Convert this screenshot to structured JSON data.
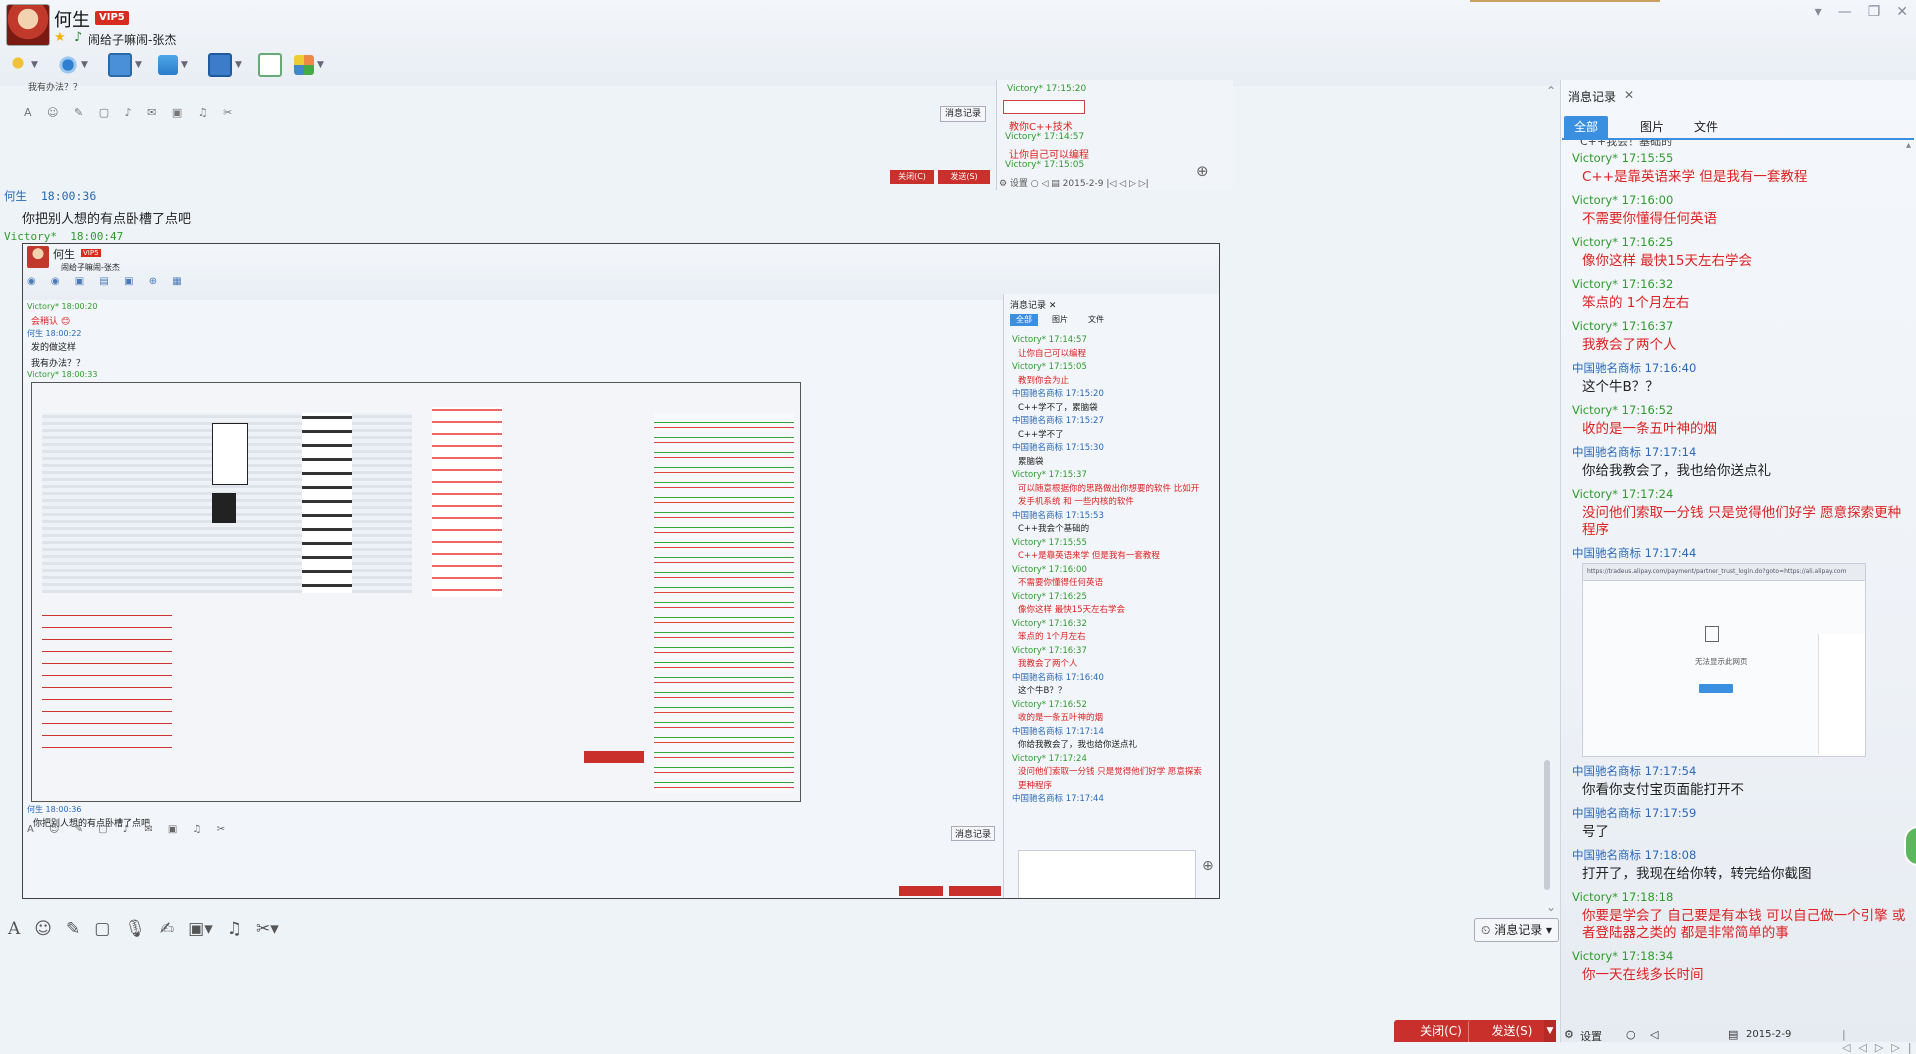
{
  "header": {
    "contact_name": "何生",
    "vip_label": "VIP5",
    "signature": "闹给子嘛闹-张杰",
    "tools": [
      "mic-icon",
      "camera-icon",
      "screen-share-icon",
      "file-transfer-icon",
      "remote-assist-icon",
      "apps-icon"
    ]
  },
  "chat": {
    "first_sender": "何生",
    "first_time": "18:00:36",
    "first_message": "你把别人想的有点卧槽了点吧",
    "second_sender": "Victory*",
    "second_time": "18:00:47",
    "screenshot_msg_top": "我有办法？？",
    "history_label": "消息记录",
    "close_label": "关闭(C)",
    "send_label": "发送(S)",
    "nested_name": "何生",
    "nested_vip": "VIP5",
    "nested_sig": "闹给子嘛闹-张杰",
    "nested_msgs": [
      {
        "meta": "Victory* 18:00:20",
        "text": "会稍认 😊"
      },
      {
        "meta": "何生 18:00:22",
        "text": "发的做这样"
      },
      {
        "meta": "",
        "text": "我有办法？？"
      },
      {
        "meta": "Victory* 18:00:33",
        "text": ""
      }
    ],
    "nested_bottom_meta": "何生 18:00:36",
    "nested_bottom_text": "你把别人想的有点卧槽了点吧"
  },
  "right_panel": {
    "title": "消息记录",
    "tabs": [
      "全部",
      "图片",
      "文件"
    ],
    "cut_top_text": "C++我会！基础的",
    "messages": [
      {
        "sender": "Victory*",
        "time": "17:15:55",
        "text": "C++是靠英语来学 但是我有一套教程",
        "kind": "v"
      },
      {
        "sender": "Victory*",
        "time": "17:16:00",
        "text": "不需要你懂得任何英语",
        "kind": "v"
      },
      {
        "sender": "Victory*",
        "time": "17:16:25",
        "text": "像你这样 最快15天左右学会",
        "kind": "v"
      },
      {
        "sender": "Victory*",
        "time": "17:16:32",
        "text": "笨点的 1个月左右",
        "kind": "v"
      },
      {
        "sender": "Victory*",
        "time": "17:16:37",
        "text": "我教会了两个人",
        "kind": "v"
      },
      {
        "sender": "中国驰名商标",
        "time": "17:16:40",
        "text": "这个牛B？？",
        "kind": "c"
      },
      {
        "sender": "Victory*",
        "time": "17:16:52",
        "text": "收的是一条五叶神的烟",
        "kind": "v"
      },
      {
        "sender": "中国驰名商标",
        "time": "17:17:14",
        "text": "你给我教会了，我也给你送点礼",
        "kind": "c"
      },
      {
        "sender": "Victory*",
        "time": "17:17:24",
        "text": "没问他们索取一分钱 只是觉得他们好学 愿意探索更种程序",
        "kind": "v"
      },
      {
        "sender": "中国驰名商标",
        "time": "17:17:44",
        "text": "",
        "kind": "c",
        "image": true
      },
      {
        "sender": "中国驰名商标",
        "time": "17:17:54",
        "text": "你看你支付宝页面能打开不",
        "kind": "c"
      },
      {
        "sender": "中国驰名商标",
        "time": "17:17:59",
        "text": "号了",
        "kind": "c"
      },
      {
        "sender": "中国驰名商标",
        "time": "17:18:08",
        "text": "打开了，我现在给你转，转完给你截图",
        "kind": "c"
      },
      {
        "sender": "Victory*",
        "time": "17:18:18",
        "text": "你要是学会了 自己要是有本钱 可以自己做一个引擎 或者登陆器之类的 都是非常简单的事",
        "kind": "v"
      },
      {
        "sender": "Victory*",
        "time": "17:18:34",
        "text": "你一天在线多长时间",
        "kind": "v"
      }
    ],
    "image_url": "https://tradeus.alipay.com/payment/partner_trust_login.do?goto=https://ali.alipay.com",
    "image_cannot_show": "无法显示此网页",
    "settings_label": "设置",
    "date": "2015-2-9"
  },
  "colors": {
    "accent": "#3b8fe0",
    "red_button": "#c9302c",
    "victory_green": "#2e9b2e",
    "partner_blue": "#2a68b8",
    "message_red": "#d22222"
  }
}
